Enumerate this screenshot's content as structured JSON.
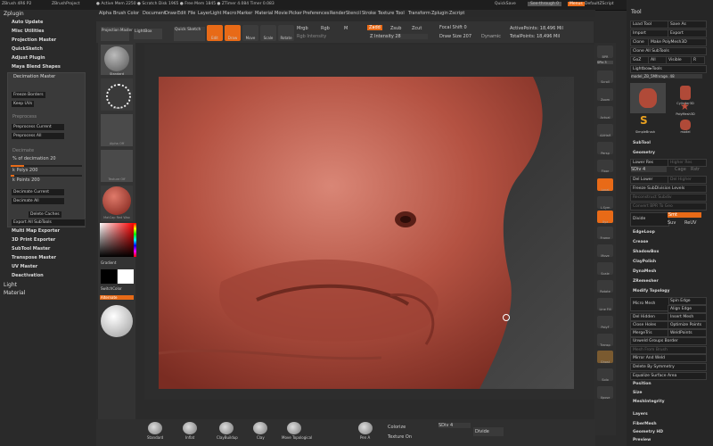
{
  "title_bar": {
    "app": "ZBrush 4R6 P2",
    "document": "ZBrushProject",
    "stats": "● Active Mem 2250 ● Scratch Disk 1965 ● Free Mem 1845 ● ZTimer 4.084 Timer 0.083",
    "quicksave": "QuickSave",
    "see_through": "See-through 0",
    "menus_btn": "Menus",
    "default_zscript": "DefaultZScript"
  },
  "menubar": [
    "Alpha",
    "Brush",
    "Color",
    "Document",
    "Draw",
    "Edit",
    "File",
    "Layer",
    "Light",
    "Macro",
    "Marker",
    "Material",
    "Movie",
    "Picker",
    "Preferences",
    "Render",
    "Stencil",
    "Stroke",
    "Texture",
    "Tool",
    "Transform",
    "Zplugin",
    "Zscript"
  ],
  "left_panel": {
    "header": "Zplugin",
    "items": [
      "Auto Update",
      "Misc Utilities",
      "Projection Master",
      "QuickSketch",
      "Adjust Plugin",
      "Maya Blend Shapes"
    ],
    "decimation_header": "Decimation Master",
    "freeze_borders": "Freeze Borders",
    "keep_uvs": "Keep UVs",
    "preprocess_label": "Preprocess",
    "preprocess_current": "Preprocess Current",
    "preprocess_all": "Preprocess All",
    "decimate_label": "Decimate",
    "pct_decimation": "% of decimation 20",
    "kpolys": "k Polys 200",
    "kpoints": "k Points 200",
    "decimate_current": "Decimate Current",
    "decimate_all": "Decimate All",
    "delete_caches": "Delete Caches",
    "export_all": "Export All SubTools",
    "more_items": [
      "Multi Map Exporter",
      "3D Print Exporter",
      "SubTool Master",
      "Transpose Master",
      "UV Master",
      "Deactivation"
    ],
    "light": "Light",
    "material": "Material"
  },
  "shelf": {
    "projection_master": "Projection Master",
    "lightbox": "LightBox",
    "quick_sketch": "Quick Sketch",
    "buttons": [
      "Edit",
      "Draw",
      "Move",
      "Scale",
      "Rotate"
    ],
    "mrgb": "Mrgb",
    "rgb": "Rgb",
    "m": "M",
    "rgb_intensity": "Rgb Intensity",
    "zadd": "Zadd",
    "zsub": "Zsub",
    "zcut": "Zcut",
    "z_intensity": "Z Intensity 28",
    "focal_shift": "Focal Shift 0",
    "draw_size": "Draw Size 207",
    "dynamic": "Dynamic",
    "active_points": "ActivePoints: 18,496 Mil",
    "total_points": "TotalPoints: 18,496 Mil"
  },
  "tool_col": [
    "Standard",
    "Dots",
    "Alpha Off",
    "Texture Off",
    "MatCap Red Wax",
    "Gradient",
    "SwitchColor",
    "Alternate"
  ],
  "right_icons": [
    "BPR",
    "SPix 3",
    "Scroll",
    "Zoom",
    "Actual",
    "AAHalf",
    "Persp",
    "Floor",
    "Local",
    "L.Sym",
    "Xyz",
    "Frame",
    "Move",
    "Scale",
    "Rotate",
    "Line Fill",
    "PolyF",
    "Transp",
    "Ghost",
    "Solo",
    "Xpose"
  ],
  "tool_panel": {
    "header": "Tool",
    "load_tool": "Load Tool",
    "save_as": "Save As",
    "import": "Import",
    "export": "Export",
    "clone": "Clone",
    "make_polymesh": "Make PolyMesh3D",
    "goz": "GoZ",
    "all": "All",
    "visible": "Visible",
    "r": "R",
    "clone_all": "Clone All SubTools",
    "lightbox_tools": "Lightbox▸Tools",
    "current_tool": "model_ZB_5Mfnrage. 48",
    "thumbs": [
      "Cylinder3D",
      "PolyMesh3D",
      "SimpleBrush",
      "model"
    ],
    "subtool": "SubTool",
    "geometry": "Geometry",
    "lower_res": "Lower Res",
    "higher_res": "Higher Res",
    "sdiv": "SDiv 4",
    "cage": "Cage",
    "rstr": "Rstr",
    "del_lower": "Del Lower",
    "del_higher": "Del Higher",
    "freeze_subdiv": "Freeze SubDivision Levels",
    "reconstruct": "Reconstruct Subdiv",
    "convert_bpr": "Convert BPR To Geo",
    "divide": "Divide",
    "smt": "Smt",
    "suv": "Suv",
    "reuv": "ReUV",
    "edgeloop": "EdgeLoop",
    "crease": "Crease",
    "shadowbox": "ShadowBox",
    "claypolish": "ClayPolish",
    "dynamesh": "DynaMesh",
    "zremesher": "ZRemesher",
    "modify_topology": "Modify Topology",
    "spin_edge": "Spin Edge",
    "micro_mesh": "Micro Mesh",
    "align_edge": "Align Edge",
    "del_hidden": "Del Hidden",
    "insert_mesh": "Insert Mesh",
    "close_holes": "Close Holes",
    "optimize_points": "Optimize Points",
    "mergetris": "MergeTris",
    "weldpoints": "WeldPoints",
    "unweld_groups": "Unweld Groups Border",
    "mesh_from_brush": "Mesh From Brush",
    "mirror_and_weld": "Mirror And Weld",
    "delete_by_symmetry": "Delete By Symmetry",
    "equalize_surface": "Equalize Surface Area",
    "position": "Position",
    "size": "Size",
    "meshintegrity": "MeshIntegrity",
    "layers": "Layers",
    "fibermesh": "FiberMesh",
    "geometry_hd": "Geometry HD",
    "preview": "Preview"
  },
  "bottom_bar": {
    "brushes": [
      "Standard",
      "Inflat",
      "ClayBuildup",
      "Clay",
      "Move Topological"
    ],
    "pen": "Pen A",
    "colorize": "Colorize",
    "texture_on": "Texture On",
    "sdiv": "SDiv 4",
    "divide": "Divide"
  },
  "colors": {
    "accent": "#e86a17",
    "panel": "#262626",
    "sculpt": "#a8433a"
  }
}
